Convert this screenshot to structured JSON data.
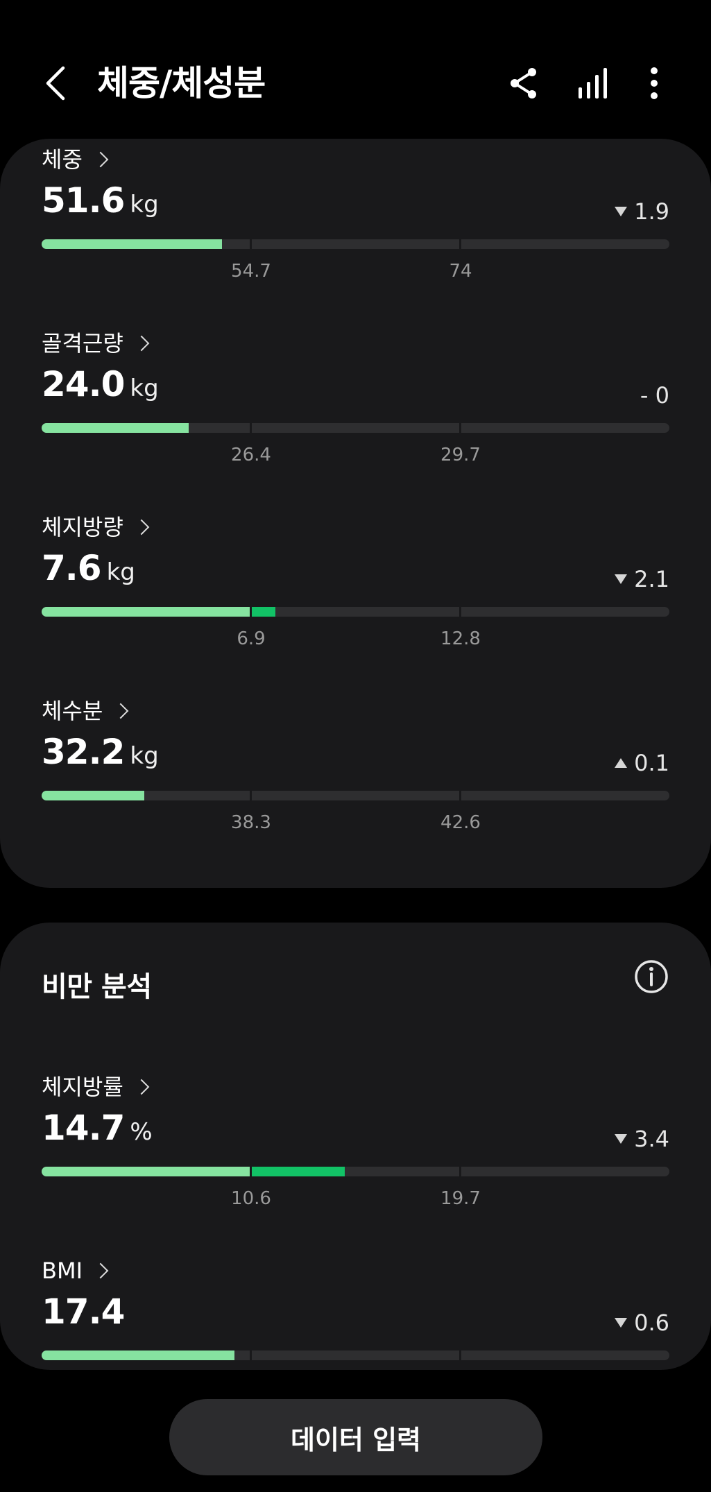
{
  "header": {
    "title": "체중/체성분",
    "back_icon": "back-arrow-icon",
    "share_icon": "share-icon",
    "chart_icon": "bar-chart-icon",
    "more_icon": "more-vertical-icon"
  },
  "body_metrics": [
    {
      "label": "체중",
      "value": "51.6",
      "unit": "kg",
      "change": "1.9",
      "trend": "down",
      "low_tick": "54.7",
      "high_tick": "74",
      "fill_value": 51.6
    },
    {
      "label": "골격근량",
      "value": "24.0",
      "unit": "kg",
      "change": "- 0",
      "trend": "none",
      "low_tick": "26.4",
      "high_tick": "29.7",
      "fill_value": 24.0
    },
    {
      "label": "체지방량",
      "value": "7.6",
      "unit": "kg",
      "change": "2.1",
      "trend": "down",
      "low_tick": "6.9",
      "high_tick": "12.8",
      "fill_value": 7.6
    },
    {
      "label": "체수분",
      "value": "32.2",
      "unit": "kg",
      "change": "0.1",
      "trend": "up",
      "low_tick": "38.3",
      "high_tick": "42.6",
      "fill_value": 32.2
    }
  ],
  "obesity": {
    "title": "비만 분석",
    "info_icon": "info-icon",
    "metrics": [
      {
        "label": "체지방률",
        "value": "14.7",
        "unit": "%",
        "change": "3.4",
        "trend": "down",
        "low_tick": "10.6",
        "high_tick": "19.7",
        "fill_value": 14.7
      },
      {
        "label": "BMI",
        "value": "17.4",
        "unit": "",
        "change": "0.6",
        "trend": "down",
        "low_tick": "",
        "high_tick": "",
        "fill_value": 17.4
      }
    ]
  },
  "bottom_button": {
    "label": "데이터 입력"
  },
  "colors": {
    "background": "#000000",
    "card": "#19191b",
    "bar_track": "#2e2e30",
    "bar_normal": "#86e3a0",
    "bar_over": "#12c266"
  }
}
